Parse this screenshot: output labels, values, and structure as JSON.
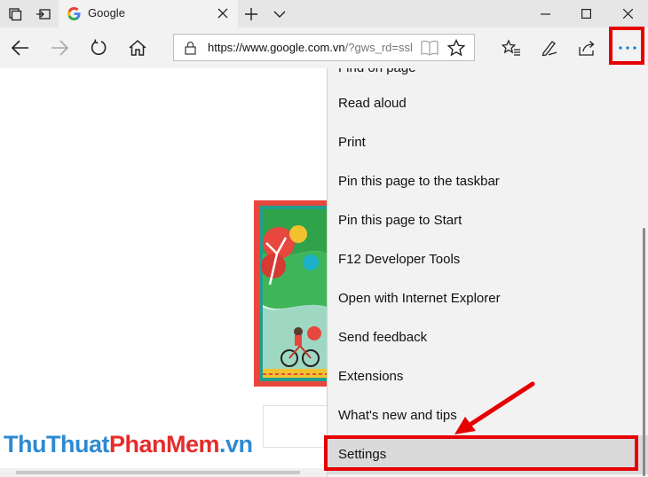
{
  "tab": {
    "title": "Google"
  },
  "address": {
    "url_host": "https://www.google.com.vn",
    "url_rest": "/?gws_rd=ssl"
  },
  "menu": {
    "items": [
      "Find on page",
      "Read aloud",
      "Print",
      "Pin this page to the taskbar",
      "Pin this page to Start",
      "F12 Developer Tools",
      "Open with Internet Explorer",
      "Send feedback",
      "Extensions",
      "What's new and tips",
      "Settings"
    ]
  },
  "watermark": {
    "part1": "ThuThuat",
    "part2": "PhanMem",
    "part3": ".vn"
  },
  "colors": {
    "highlight": "#e60000",
    "menu_bg": "#f2f2f2",
    "accent": "#0078d7"
  },
  "icons": [
    "tab-set-aside-icon",
    "tabs-preview-icon",
    "google-g-icon",
    "close-icon",
    "new-tab-plus-icon",
    "chevron-down-icon",
    "minimize-icon",
    "maximize-icon",
    "window-close-icon",
    "back-arrow-icon",
    "forward-arrow-icon",
    "refresh-icon",
    "home-icon",
    "lock-icon",
    "reading-view-icon",
    "favorite-star-icon",
    "favorites-hub-icon",
    "web-note-icon",
    "share-icon",
    "more-ellipsis-icon"
  ]
}
